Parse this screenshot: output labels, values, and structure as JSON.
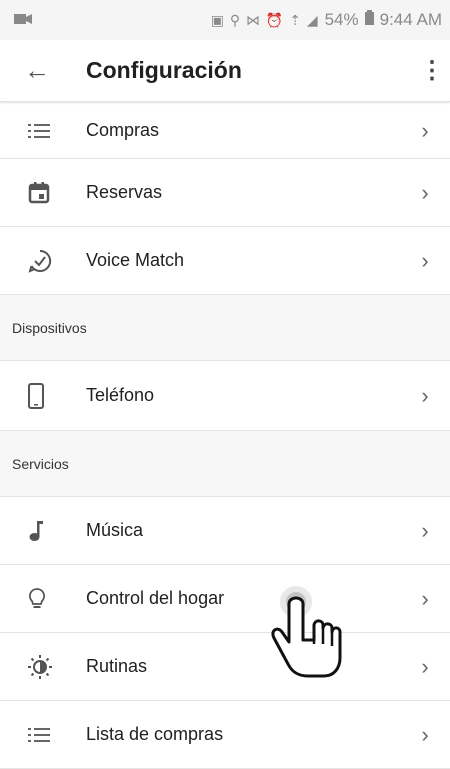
{
  "status": {
    "left_icon": "video-icon",
    "icons": "▣ ⚲ ⋈ ⏰ ⇡ ◢",
    "battery": "54%",
    "time": "9:44 AM"
  },
  "appbar": {
    "title": "Configuración",
    "back_icon": "←",
    "more_icon": "⋮"
  },
  "items": {
    "compras": "Compras",
    "reservas": "Reservas",
    "voice_match": "Voice Match",
    "section_dispositivos": "Dispositivos",
    "telefono": "Teléfono",
    "section_servicios": "Servicios",
    "musica": "Música",
    "control_hogar": "Control del hogar",
    "rutinas": "Rutinas",
    "lista_compras": "Lista de compras"
  },
  "chevron": "›"
}
